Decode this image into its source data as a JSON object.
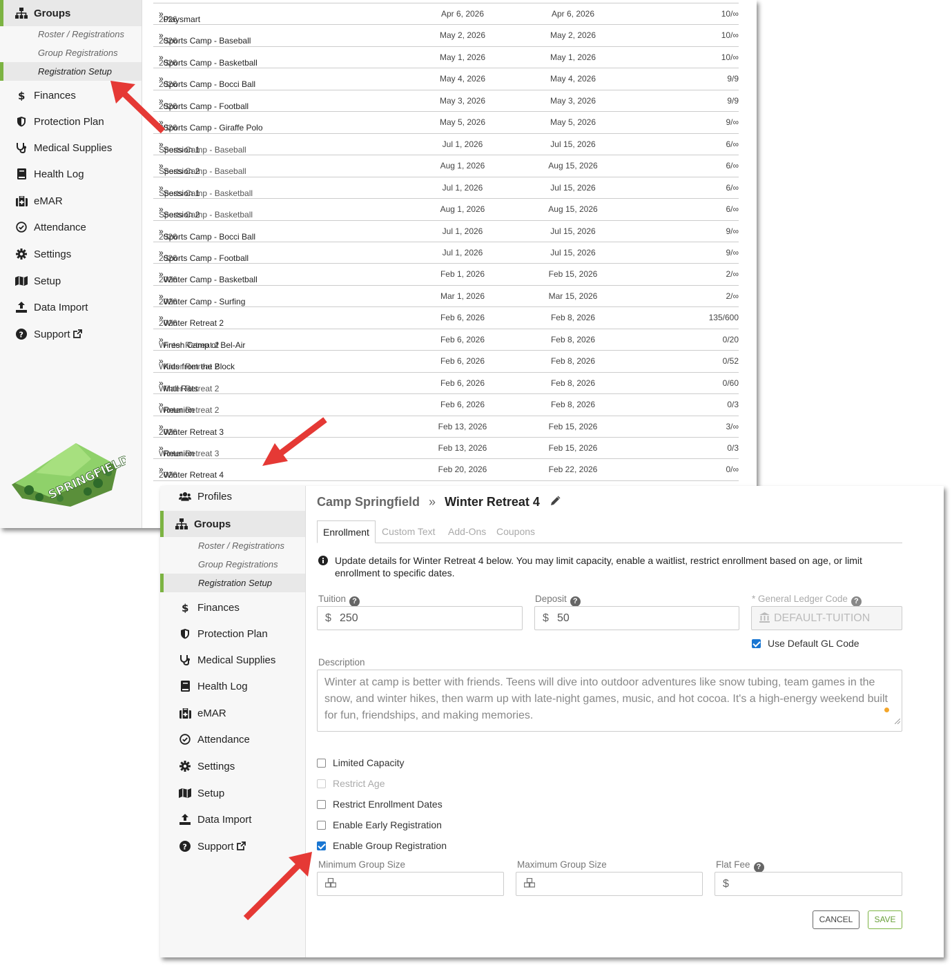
{
  "sidebar": {
    "groups": "Groups",
    "roster": "Roster / Registrations",
    "group_reg": "Group Registrations",
    "reg_setup": "Registration Setup",
    "finances": "Finances",
    "protection": "Protection Plan",
    "medical": "Medical Supplies",
    "health": "Health Log",
    "emar": "eMAR",
    "attendance": "Attendance",
    "settings": "Settings",
    "setup": "Setup",
    "import": "Data Import",
    "support": "Support",
    "profiles": "Profiles",
    "logo_text": "SPRINGFIELD"
  },
  "table": {
    "rows": [
      {
        "pre": "2026",
        "name": "Playsmart",
        "start": "Apr 6, 2026",
        "end": "Apr 6, 2026",
        "cap": "10/∞"
      },
      {
        "pre": "2026",
        "name": "Sports Camp - Baseball",
        "start": "May 2, 2026",
        "end": "May 2, 2026",
        "cap": "10/∞"
      },
      {
        "pre": "2026",
        "name": "Sports Camp - Basketball",
        "start": "May 1, 2026",
        "end": "May 1, 2026",
        "cap": "10/∞"
      },
      {
        "pre": "2026",
        "name": "Sports Camp - Bocci Ball",
        "start": "May 4, 2026",
        "end": "May 4, 2026",
        "cap": "9/9"
      },
      {
        "pre": "2026",
        "name": "Sports Camp - Football",
        "start": "May 3, 2026",
        "end": "May 3, 2026",
        "cap": "9/9"
      },
      {
        "pre": "2026",
        "name": "Sports Camp - Giraffe Polo",
        "start": "May 5, 2026",
        "end": "May 5, 2026",
        "cap": "9/∞"
      },
      {
        "pre": "Sports Camp - Baseball",
        "name": "Session 1",
        "start": "Jul 1, 2026",
        "end": "Jul 15, 2026",
        "cap": "6/∞"
      },
      {
        "pre": "Sports Camp - Baseball",
        "name": "Session 2",
        "start": "Aug 1, 2026",
        "end": "Aug 15, 2026",
        "cap": "6/∞"
      },
      {
        "pre": "Sports Camp - Basketball",
        "name": "Session 1",
        "start": "Jul 1, 2026",
        "end": "Jul 15, 2026",
        "cap": "6/∞"
      },
      {
        "pre": "Sports Camp - Basketball",
        "name": "Session 2",
        "start": "Aug 1, 2026",
        "end": "Aug 15, 2026",
        "cap": "6/∞"
      },
      {
        "pre": "2026",
        "name": "Sports Camp - Bocci Ball",
        "start": "Jul 1, 2026",
        "end": "Jul 15, 2026",
        "cap": "9/∞"
      },
      {
        "pre": "2026",
        "name": "Sports Camp - Football",
        "start": "Jul 1, 2026",
        "end": "Jul 15, 2026",
        "cap": "9/∞"
      },
      {
        "pre": "2026",
        "name": "Winter Camp - Basketball",
        "start": "Feb 1, 2026",
        "end": "Feb 15, 2026",
        "cap": "2/∞"
      },
      {
        "pre": "2026",
        "name": "Winter Camp - Surfing",
        "start": "Mar 1, 2026",
        "end": "Mar 15, 2026",
        "cap": "2/∞"
      },
      {
        "pre": "2026",
        "name": "Winter Retreat 2",
        "start": "Feb 6, 2026",
        "end": "Feb 8, 2026",
        "cap": "135/600"
      },
      {
        "pre": "Winter Retreat 2",
        "name": "Fresh Camp of Bel-Air",
        "start": "Feb 6, 2026",
        "end": "Feb 8, 2026",
        "cap": "0/20"
      },
      {
        "pre": "Winter Retreat 2",
        "name": "Kids from the Block",
        "start": "Feb 6, 2026",
        "end": "Feb 8, 2026",
        "cap": "0/52"
      },
      {
        "pre": "Winter Retreat 2",
        "name": "Mall Rats",
        "start": "Feb 6, 2026",
        "end": "Feb 8, 2026",
        "cap": "0/60"
      },
      {
        "pre": "Winter Retreat 2",
        "name": "Reunion",
        "start": "Feb 6, 2026",
        "end": "Feb 8, 2026",
        "cap": "0/3"
      },
      {
        "pre": "2026",
        "name": "Winter Retreat 3",
        "start": "Feb 13, 2026",
        "end": "Feb 15, 2026",
        "cap": "3/∞"
      },
      {
        "pre": "Winter Retreat 3",
        "name": "Reunion",
        "start": "Feb 13, 2026",
        "end": "Feb 15, 2026",
        "cap": "0/3"
      },
      {
        "pre": "2026",
        "name": "Winter Retreat 4",
        "start": "Feb 20, 2026",
        "end": "Feb 22, 2026",
        "cap": "0/∞"
      }
    ]
  },
  "form": {
    "crumb_parent": "Camp Springfield",
    "crumb_sep": "»",
    "crumb_current": "Winter Retreat 4",
    "tabs": [
      "Enrollment",
      "Custom Text",
      "Add-Ons",
      "Coupons"
    ],
    "info": "Update details for Winter Retreat 4 below. You may limit capacity, enable a waitlist, restrict enrollment based on age, or limit enrollment to specific dates.",
    "tuition_label": "Tuition",
    "tuition_value": "250",
    "deposit_label": "Deposit",
    "deposit_value": "50",
    "gl_label": "General Ledger Code",
    "gl_placeholder": "DEFAULT-TUITION",
    "gl_required": "*",
    "use_default_gl": "Use Default GL Code",
    "desc_label": "Description",
    "desc_value": "Winter at camp is better with friends. Teens will dive into outdoor adventures like snow tubing, team games in the snow, and winter hikes, then warm up with late-night games, music, and hot cocoa. It's a high-energy weekend built for fun, friendships, and making memories.",
    "limited_capacity": "Limited Capacity",
    "restrict_age": "Restrict Age",
    "restrict_dates": "Restrict Enrollment Dates",
    "early_reg": "Enable Early Registration",
    "group_reg": "Enable Group Registration",
    "min_group": "Minimum Group Size",
    "max_group": "Maximum Group Size",
    "flat_fee": "Flat Fee",
    "cancel": "CANCEL",
    "save": "SAVE"
  },
  "colors": {
    "accent": "#7cb342",
    "arrow": "#e53935",
    "checkbox": "#1976d2"
  }
}
